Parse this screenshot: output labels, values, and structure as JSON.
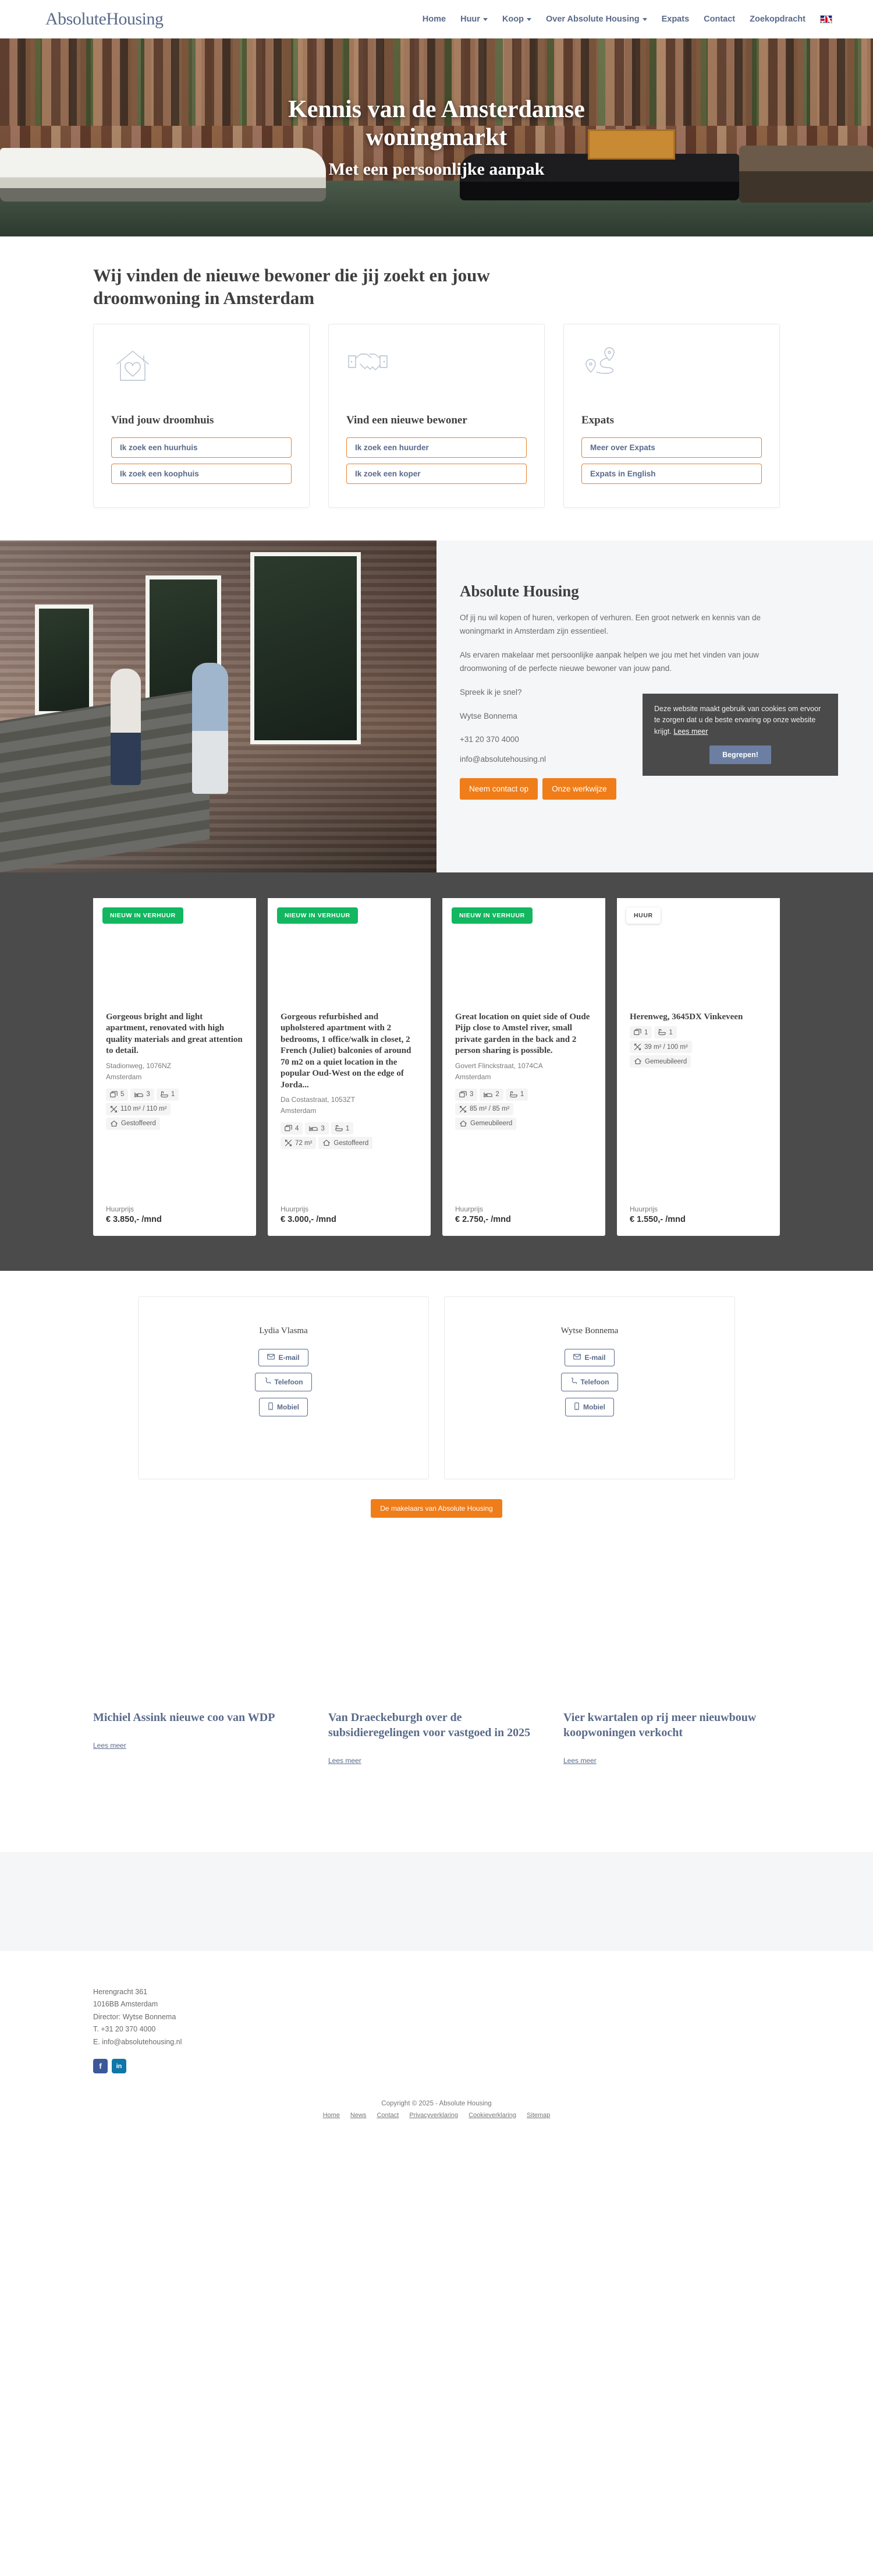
{
  "header": {
    "logo": "AbsoluteHousing",
    "nav": [
      {
        "label": "Home",
        "caret": false
      },
      {
        "label": "Huur",
        "caret": true
      },
      {
        "label": "Koop",
        "caret": true
      },
      {
        "label": "Over Absolute Housing",
        "caret": true
      },
      {
        "label": "Expats",
        "caret": false
      },
      {
        "label": "Contact",
        "caret": false
      },
      {
        "label": "Zoekopdracht",
        "caret": false
      }
    ],
    "language_flag": "uk-flag-icon"
  },
  "hero": {
    "title": "Kennis van de Amsterdamse woningmarkt",
    "subtitle": "Met een persoonlijke aanpak"
  },
  "services": {
    "title": "Wij vinden de nieuwe bewoner die jij zoekt en jouw droomwoning in Amsterdam",
    "cards": [
      {
        "icon": "house-heart-icon",
        "title": "Vind jouw droomhuis",
        "buttons": [
          "Ik zoek een huurhuis",
          "Ik zoek een koophuis"
        ]
      },
      {
        "icon": "handshake-icon",
        "title": "Vind een nieuwe bewoner",
        "buttons": [
          "Ik zoek een huurder",
          "Ik zoek een koper"
        ]
      },
      {
        "icon": "map-route-icon",
        "title": "Expats",
        "buttons": [
          "Meer over Expats",
          "Expats in English"
        ]
      }
    ]
  },
  "cookie": {
    "text": "Deze website maakt gebruik van cookies om ervoor te zorgen dat u de beste ervaring op onze website krijgt.",
    "link": "Lees meer",
    "button": "Begrepen!",
    "bg_color": "#4a4a4a",
    "button_color": "#6c7fa3"
  },
  "about": {
    "title": "Absolute Housing",
    "paragraph1": "Of jij nu wil kopen of huren, verkopen of verhuren. Een groot netwerk en kennis van de woningmarkt in Amsterdam zijn essentieel.",
    "paragraph2": "Als ervaren makelaar met persoonlijke aanpak helpen we jou met het vinden van jouw droomwoning of de perfecte nieuwe bewoner van jouw pand.",
    "paragraph3": "Spreek ik je snel?",
    "paragraph4": "Wytse Bonnema",
    "phone": "+31 20 370 4000",
    "email": "info@absolutehousing.nl",
    "buttons": [
      "Neem contact op",
      "Onze werkwijze"
    ]
  },
  "listings": [
    {
      "badge": "NIEUW IN VERHUUR",
      "badge_style": "green",
      "title": "Gorgeous bright and light apartment, renovated with high quality materials and great attention to detail.",
      "address_line1": "Stadionweg, 1076NZ",
      "address_line2": "Amsterdam",
      "features": [
        {
          "icon": "rooms-icon",
          "value": "5"
        },
        {
          "icon": "bed-icon",
          "value": "3"
        },
        {
          "icon": "bath-icon",
          "value": "1"
        }
      ],
      "area": "110 m² / 110 m²",
      "furnishing": "Gestoffeerd",
      "price_label": "Huurprijs",
      "price": "€ 3.850,- /mnd"
    },
    {
      "badge": "NIEUW IN VERHUUR",
      "badge_style": "green",
      "title": "Gorgeous refurbished and upholstered apartment with 2 bedrooms, 1 office/walk in closet, 2 French (Juliet) balconies of around 70 m2 on a quiet location in the popular Oud-West on the edge of Jorda...",
      "address_line1": "Da Costastraat, 1053ZT",
      "address_line2": "Amsterdam",
      "features": [
        {
          "icon": "rooms-icon",
          "value": "4"
        },
        {
          "icon": "bed-icon",
          "value": "3"
        },
        {
          "icon": "bath-icon",
          "value": "1"
        }
      ],
      "area": "72 m²",
      "furnishing": "Gestoffeerd",
      "price_label": "Huurprijs",
      "price": "€ 3.000,- /mnd"
    },
    {
      "badge": "NIEUW IN VERHUUR",
      "badge_style": "green",
      "title": "Great location on quiet side of Oude Pijp close to Amstel river, small private garden in the back and 2 person sharing is possible.",
      "address_line1": "Govert Flinckstraat, 1074CA",
      "address_line2": "Amsterdam",
      "features": [
        {
          "icon": "rooms-icon",
          "value": "3"
        },
        {
          "icon": "bed-icon",
          "value": "2"
        },
        {
          "icon": "bath-icon",
          "value": "1"
        }
      ],
      "area": "85 m² / 85 m²",
      "furnishing": "Gemeubileerd",
      "price_label": "Huurprijs",
      "price": "€ 2.750,- /mnd"
    },
    {
      "badge": "HUUR",
      "badge_style": "plain",
      "title": "Herenweg, 3645DX Vinkeveen",
      "address_line1": "",
      "address_line2": "",
      "features": [
        {
          "icon": "rooms-icon",
          "value": "1"
        },
        {
          "icon": "bath-icon",
          "value": "1"
        }
      ],
      "area": "39 m² / 100 m²",
      "furnishing": "Gemeubileerd",
      "price_label": "Huurprijs",
      "price": "€ 1.550,- /mnd"
    }
  ],
  "agents": {
    "people": [
      {
        "name": "Lydia Vlasma",
        "buttons": [
          {
            "icon": "envelope-icon",
            "label": "E-mail"
          },
          {
            "icon": "phone-icon",
            "label": "Telefoon"
          },
          {
            "icon": "mobile-icon",
            "label": "Mobiel"
          }
        ]
      },
      {
        "name": "Wytse Bonnema",
        "buttons": [
          {
            "icon": "envelope-icon",
            "label": "E-mail"
          },
          {
            "icon": "phone-icon",
            "label": "Telefoon"
          },
          {
            "icon": "mobile-icon",
            "label": "Mobiel"
          }
        ]
      }
    ],
    "cta": "De makelaars van Absolute Housing"
  },
  "news": [
    {
      "title": "Michiel Assink nieuwe coo van WDP",
      "link": "Lees meer"
    },
    {
      "title": "Van Draeckeburgh over de subsidieregelingen voor vastgoed in 2025",
      "link": "Lees meer"
    },
    {
      "title": "Vier kwartalen op rij meer nieuwbouw koopwoningen verkocht",
      "link": "Lees meer"
    }
  ],
  "footer": {
    "address": [
      "Herengracht 361",
      "1016BB Amsterdam",
      "Director: Wytse Bonnema",
      "T. +31 20 370 4000",
      "E. info@absolutehousing.nl"
    ],
    "socials": [
      {
        "icon": "facebook-icon",
        "glyph": "f"
      },
      {
        "icon": "linkedin-icon",
        "glyph": "in"
      }
    ],
    "copyright": "Copyright © 2025 - Absolute Housing",
    "links": [
      "Home",
      "News",
      "Contact",
      "Privacyverklaring",
      "Cookieverklaring",
      "Sitemap"
    ]
  },
  "colors": {
    "accent_orange": "#ef7d1a",
    "brand_blue": "#5a6a8a",
    "badge_green": "#12b760",
    "dark_section": "#4b4b4b"
  }
}
